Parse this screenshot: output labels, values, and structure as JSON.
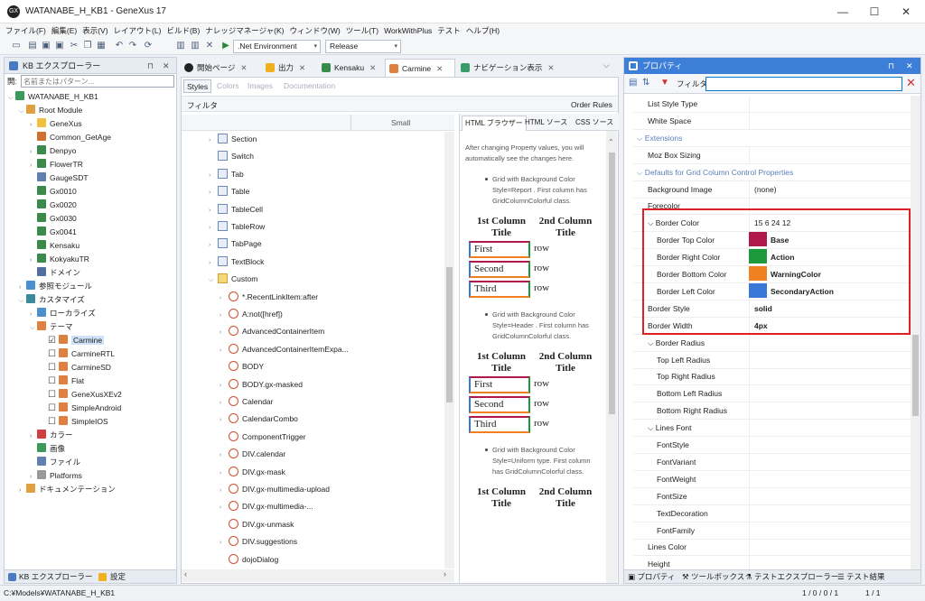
{
  "window": {
    "title": "WATANABE_H_KB1 - GeneXus 17",
    "logo": "GX"
  },
  "menu": [
    "ファイル(F)",
    "編集(E)",
    "表示(V)",
    "レイアウト(L)",
    "ビルド(B)",
    "ナレッジマネージャ(K)",
    "ウィンドウ(W)",
    "ツール(T)",
    "WorkWithPlus",
    "テスト",
    "ヘルプ(H)"
  ],
  "toolbar": {
    "environment": ".Net Environment",
    "config": "Release"
  },
  "kb_explorer": {
    "title": "KB エクスプローラー",
    "search_label": "開:",
    "search_placeholder": "名前またはパターン...",
    "items": [
      {
        "label": "WATANABE_H_KB1",
        "depth": 0,
        "color": "#3a9a5a",
        "tw": "⌵"
      },
      {
        "label": "Root Module",
        "depth": 1,
        "color": "#e0a040",
        "tw": "⌵"
      },
      {
        "label": "GeneXus",
        "depth": 2,
        "color": "#f0c040",
        "tw": "›"
      },
      {
        "label": "Common_GetAge",
        "depth": 2,
        "color": "#d07030",
        "tw": ""
      },
      {
        "label": "Denpyo",
        "depth": 2,
        "color": "#3a8a4a",
        "tw": "›"
      },
      {
        "label": "FlowerTR",
        "depth": 2,
        "color": "#3a8a4a",
        "tw": "›"
      },
      {
        "label": "GaugeSDT",
        "depth": 2,
        "color": "#6080b0",
        "tw": ""
      },
      {
        "label": "Gx0010",
        "depth": 2,
        "color": "#3a8a4a",
        "tw": ""
      },
      {
        "label": "Gx0020",
        "depth": 2,
        "color": "#3a8a4a",
        "tw": ""
      },
      {
        "label": "Gx0030",
        "depth": 2,
        "color": "#3a8a4a",
        "tw": ""
      },
      {
        "label": "Gx0041",
        "depth": 2,
        "color": "#3a8a4a",
        "tw": ""
      },
      {
        "label": "Kensaku",
        "depth": 2,
        "color": "#3a8a4a",
        "tw": ""
      },
      {
        "label": "KokyakuTR",
        "depth": 2,
        "color": "#3a8a4a",
        "tw": "›"
      },
      {
        "label": "ドメイン",
        "depth": 2,
        "color": "#5070a0",
        "tw": ""
      },
      {
        "label": "参照モジュール",
        "depth": 1,
        "color": "#4a90d0",
        "tw": "›"
      },
      {
        "label": "カスタマイズ",
        "depth": 1,
        "color": "#3a8a9a",
        "tw": "⌵"
      },
      {
        "label": "ローカライズ",
        "depth": 2,
        "color": "#4a90d0",
        "tw": "›"
      },
      {
        "label": "テーマ",
        "depth": 2,
        "color": "#e08040",
        "tw": "⌵"
      },
      {
        "label": "Carmine",
        "depth": 3,
        "color": "#e08040",
        "tw": "",
        "checked": true
      },
      {
        "label": "CarmineRTL",
        "depth": 3,
        "color": "#e08040",
        "tw": ""
      },
      {
        "label": "CarmineSD",
        "depth": 3,
        "color": "#e08040",
        "tw": ""
      },
      {
        "label": "Flat",
        "depth": 3,
        "color": "#e08040",
        "tw": ""
      },
      {
        "label": "GeneXusXEv2",
        "depth": 3,
        "color": "#e08040",
        "tw": ""
      },
      {
        "label": "SimpleAndroid",
        "depth": 3,
        "color": "#e08040",
        "tw": ""
      },
      {
        "label": "SimpleIOS",
        "depth": 3,
        "color": "#e08040",
        "tw": ""
      },
      {
        "label": "カラー",
        "depth": 2,
        "color": "#d04040",
        "tw": "›"
      },
      {
        "label": "画像",
        "depth": 2,
        "color": "#3a9a5a",
        "tw": ""
      },
      {
        "label": "ファイル",
        "depth": 2,
        "color": "#6080b0",
        "tw": ""
      },
      {
        "label": "Platforms",
        "depth": 2,
        "color": "#999999",
        "tw": "›"
      },
      {
        "label": "ドキュメンテーション",
        "depth": 1,
        "color": "#e0a040",
        "tw": "›"
      }
    ],
    "bottom_tabs": [
      "KB エクスプローラー",
      "設定"
    ]
  },
  "doc_tabs": [
    "開始ページ",
    "出力",
    "Kensaku",
    "Carmine",
    "ナビゲーション表示"
  ],
  "sub_tabs": [
    "Styles",
    "Colors",
    "Images",
    "Documentation"
  ],
  "filter_label": "フィルタ",
  "order_rules": "Order Rules",
  "size_label": "Small",
  "styles": [
    {
      "label": "Section",
      "tw": "›"
    },
    {
      "label": "Switch",
      "tw": ""
    },
    {
      "label": "Tab",
      "tw": "›"
    },
    {
      "label": "Table",
      "tw": "›"
    },
    {
      "label": "TableCell",
      "tw": "›"
    },
    {
      "label": "TableRow",
      "tw": "›"
    },
    {
      "label": "TabPage",
      "tw": "›"
    },
    {
      "label": "TextBlock",
      "tw": "›"
    },
    {
      "label": "Custom",
      "tw": "⌵"
    },
    {
      "label": "*.RecentLinkItem:after",
      "tw": "›"
    },
    {
      "label": "A:not([href])",
      "tw": "›"
    },
    {
      "label": "AdvancedContainerItem",
      "tw": "›"
    },
    {
      "label": "AdvancedContainerItemExpa...",
      "tw": "›"
    },
    {
      "label": "BODY",
      "tw": ""
    },
    {
      "label": "BODY.gx-masked",
      "tw": "›"
    },
    {
      "label": "Calendar",
      "tw": "›"
    },
    {
      "label": "CalendarCombo",
      "tw": "›"
    },
    {
      "label": "ComponentTrigger",
      "tw": ""
    },
    {
      "label": "DIV.calendar",
      "tw": "›"
    },
    {
      "label": "DIV.gx-mask",
      "tw": "›"
    },
    {
      "label": "DIV.gx-multimedia-upload",
      "tw": "›"
    },
    {
      "label": "DIV.gx-multimedia-...",
      "tw": "›"
    },
    {
      "label": "DIV.gx-unmask",
      "tw": ""
    },
    {
      "label": "DIV.suggestions",
      "tw": "›"
    },
    {
      "label": "dojoDialog",
      "tw": ""
    }
  ],
  "preview": {
    "tabs": [
      "HTML ブラウザー",
      "HTML ソース",
      "CSS ソース"
    ],
    "intro": "After changing Property values, you will automatically see the changes here.",
    "bullet1": "Grid with Background Color Style=Report . First column has GridColumnColorful class.",
    "bullet2": "Grid with Background Color Style=Header . First column has GridColumnColorful class.",
    "bullet3": "Grid with Background Color Style=Uniform type. First column has GridColumnColorful class.",
    "col1": "1st Column Title",
    "col2": "2nd Column Title",
    "rows": [
      "First",
      "Second",
      "Third"
    ],
    "row_label": "row"
  },
  "properties": {
    "title": "プロパティ",
    "filter_label": "フィルタ",
    "rows": [
      {
        "name": "List Style Type",
        "value": "",
        "indent": 0
      },
      {
        "name": "White Space",
        "value": "",
        "indent": 0
      },
      {
        "name": "⌵ Extensions",
        "value": "",
        "indent": 0,
        "section": true
      },
      {
        "name": "Moz Box Sizing",
        "value": "",
        "indent": 0
      },
      {
        "name": "⌵ Defaults for Grid Column Control Properties",
        "value": "",
        "indent": 0,
        "section": true
      },
      {
        "name": "Background Image",
        "value": "(none)",
        "indent": 0
      },
      {
        "name": "Forecolor",
        "value": "",
        "indent": 0
      },
      {
        "name": "⌵ Border Color",
        "value": "15 6 24 12",
        "indent": 0
      },
      {
        "name": "Border Top Color",
        "value": "Base",
        "indent": 1,
        "color": "#b0174a"
      },
      {
        "name": "Border Right Color",
        "value": "Action",
        "indent": 1,
        "color": "#1a9a3a"
      },
      {
        "name": "Border Bottom Color",
        "value": "WarningColor",
        "indent": 1,
        "color": "#f08020"
      },
      {
        "name": "Border Left Color",
        "value": "SecondaryAction",
        "indent": 1,
        "color": "#3a78d8"
      },
      {
        "name": "Border Style",
        "value": "solid",
        "indent": 0
      },
      {
        "name": "Border Width",
        "value": "4px",
        "indent": 0
      },
      {
        "name": "⌵ Border Radius",
        "value": "",
        "indent": 0
      },
      {
        "name": "Top Left Radius",
        "value": "",
        "indent": 1
      },
      {
        "name": "Top Right Radius",
        "value": "",
        "indent": 1
      },
      {
        "name": "Bottom Left Radius",
        "value": "",
        "indent": 1
      },
      {
        "name": "Bottom Right Radius",
        "value": "",
        "indent": 1
      },
      {
        "name": "⌵ Lines Font",
        "value": "",
        "indent": 0
      },
      {
        "name": "FontStyle",
        "value": "",
        "indent": 1
      },
      {
        "name": "FontVariant",
        "value": "",
        "indent": 1
      },
      {
        "name": "FontWeight",
        "value": "",
        "indent": 1
      },
      {
        "name": "FontSize",
        "value": "",
        "indent": 1
      },
      {
        "name": "TextDecoration",
        "value": "",
        "indent": 1
      },
      {
        "name": "FontFamily",
        "value": "",
        "indent": 1
      },
      {
        "name": "Lines Color",
        "value": "",
        "indent": 0
      },
      {
        "name": "Height",
        "value": "",
        "indent": 0
      }
    ],
    "bottom_tabs": [
      "プロパティ",
      "ツールボックス",
      "テストエクスプローラー",
      "テスト結果"
    ]
  },
  "status": {
    "path": "C:¥Models¥WATANABE_H_KB1",
    "pos": "1 / 0 / 0 / 1",
    "page": "1 / 1"
  },
  "colors": {
    "highlight": "#e02020",
    "accent": "#0078d4"
  }
}
